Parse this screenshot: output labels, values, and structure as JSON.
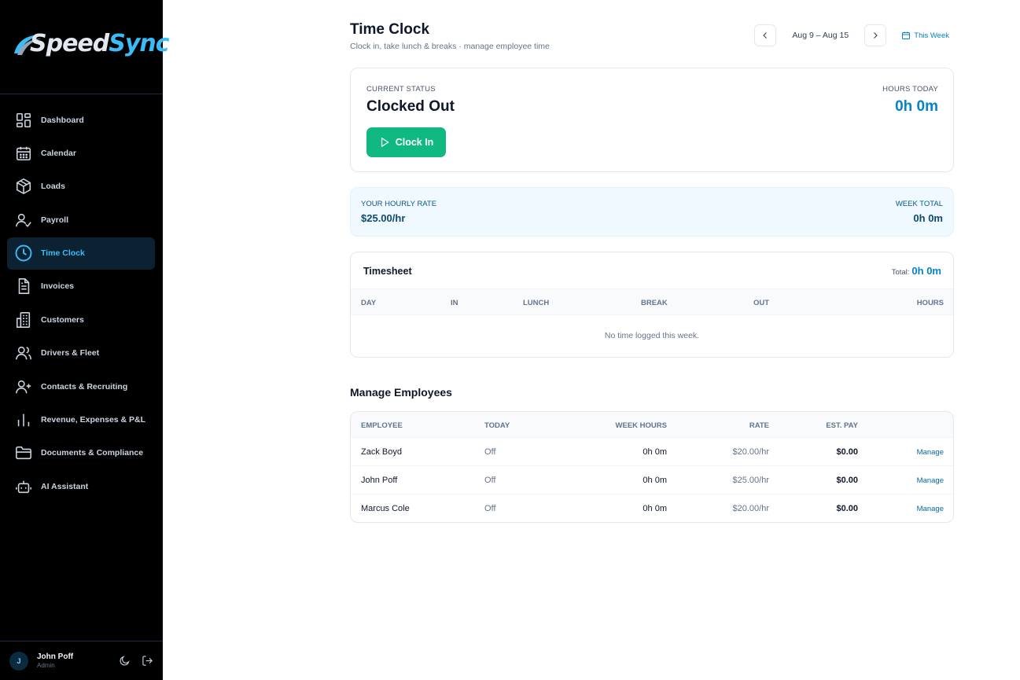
{
  "brand": {
    "name_part1": "Speed",
    "name_part2": "Sync"
  },
  "sidebar": {
    "items": [
      {
        "label": "Dashboard",
        "icon": "dashboard-icon",
        "active": false
      },
      {
        "label": "Calendar",
        "icon": "calendar-icon",
        "active": false
      },
      {
        "label": "Loads",
        "icon": "package-icon",
        "active": false
      },
      {
        "label": "Payroll",
        "icon": "user-check-icon",
        "active": false
      },
      {
        "label": "Time Clock",
        "icon": "clock-icon",
        "active": true
      },
      {
        "label": "Invoices",
        "icon": "document-icon",
        "active": false
      },
      {
        "label": "Customers",
        "icon": "building-icon",
        "active": false
      },
      {
        "label": "Drivers & Fleet",
        "icon": "users-icon",
        "active": false
      },
      {
        "label": "Contacts & Recruiting",
        "icon": "user-plus-icon",
        "active": false
      },
      {
        "label": "Revenue, Expenses & P&L",
        "icon": "bar-chart-icon",
        "active": false
      },
      {
        "label": "Documents & Compliance",
        "icon": "folder-icon",
        "active": false
      },
      {
        "label": "AI Assistant",
        "icon": "bot-icon",
        "active": false
      }
    ]
  },
  "user": {
    "initial": "J",
    "name": "John Poff",
    "role": "Admin"
  },
  "header": {
    "title": "Time Clock",
    "subtitle": "Clock in, take lunch & breaks · manage employee time",
    "week_range": "Aug 9 – Aug 15",
    "this_week_label": "This Week"
  },
  "status": {
    "current_label": "CURRENT STATUS",
    "current_value": "Clocked Out",
    "hours_label": "HOURS TODAY",
    "hours_value": "0h 0m",
    "clock_in_label": "Clock In"
  },
  "rate": {
    "rate_label": "YOUR HOURLY RATE",
    "rate_value": "$25.00/hr",
    "week_label": "WEEK TOTAL",
    "week_value": "0h 0m"
  },
  "timesheet": {
    "title": "Timesheet",
    "total_label": "Total:",
    "total_value": "0h 0m",
    "columns": [
      "DAY",
      "IN",
      "LUNCH",
      "BREAK",
      "OUT",
      "HOURS"
    ],
    "empty_text": "No time logged this week."
  },
  "employees": {
    "title": "Manage Employees",
    "columns": [
      "EMPLOYEE",
      "TODAY",
      "WEEK HOURS",
      "RATE",
      "EST. PAY"
    ],
    "rows": [
      {
        "name": "Zack Boyd",
        "today": "Off",
        "week_hours": "0h 0m",
        "rate": "$20.00/hr",
        "est_pay": "$0.00",
        "action": "Manage"
      },
      {
        "name": "John Poff",
        "today": "Off",
        "week_hours": "0h 0m",
        "rate": "$25.00/hr",
        "est_pay": "$0.00",
        "action": "Manage"
      },
      {
        "name": "Marcus Cole",
        "today": "Off",
        "week_hours": "0h 0m",
        "rate": "$20.00/hr",
        "est_pay": "$0.00",
        "action": "Manage"
      }
    ]
  },
  "colors": {
    "sidebar_bg": "#000000",
    "accent": "#0284c7",
    "active_nav": "#38bdf8",
    "clock_in_green": "#10b981"
  }
}
